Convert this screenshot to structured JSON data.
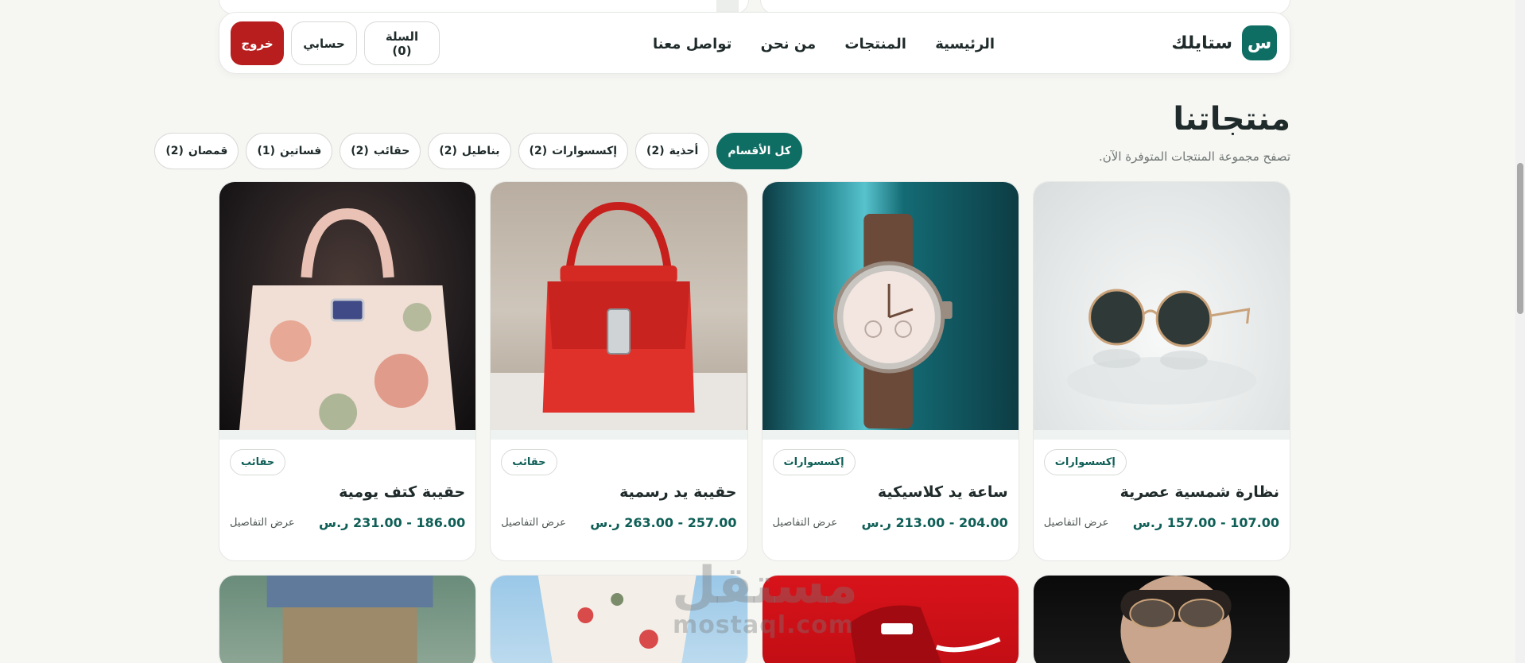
{
  "header": {
    "brand_mark": "س",
    "brand_name": "ستايلك",
    "nav": [
      "الرئيسية",
      "المنتجات",
      "من نحن",
      "تواصل معنا"
    ],
    "cart_label": "السلة (0)",
    "account_label": "حسابي",
    "logout_label": "خروج"
  },
  "section": {
    "title": "منتجاتنا",
    "subtitle": "تصفح مجموعة المنتجات المتوفرة الآن."
  },
  "filters": [
    {
      "label": "كل الأقسام",
      "count": "",
      "active": true
    },
    {
      "label": "أحذية",
      "count": "(2)"
    },
    {
      "label": "إكسسوارات",
      "count": "(2)"
    },
    {
      "label": "بناطيل",
      "count": "(2)"
    },
    {
      "label": "حقائب",
      "count": "(2)"
    },
    {
      "label": "فساتين",
      "count": "(1)"
    },
    {
      "label": "قمصان",
      "count": "(2)"
    }
  ],
  "products": [
    {
      "category": "إكسسوارات",
      "title": "نظارة شمسية عصرية",
      "price": "107.00 - 157.00 ر.س",
      "details": "عرض التفاصيل",
      "image": "sunglasses"
    },
    {
      "category": "إكسسوارات",
      "title": "ساعة يد كلاسيكية",
      "price": "204.00 - 213.00 ر.س",
      "details": "عرض التفاصيل",
      "image": "watch"
    },
    {
      "category": "حقائب",
      "title": "حقيبة يد رسمية",
      "price": "257.00 - 263.00 ر.س",
      "details": "عرض التفاصيل",
      "image": "red-handbag"
    },
    {
      "category": "حقائب",
      "title": "حقيبة كتف يومية",
      "price": "186.00 - 231.00 ر.س",
      "details": "عرض التفاصيل",
      "image": "floral-bag"
    }
  ],
  "watermark": {
    "ar": "مستقل",
    "en": "mostaql.com"
  },
  "colors": {
    "brand": "#0f6e63",
    "logout": "#b81e1e",
    "background": "#f6f6f3"
  }
}
